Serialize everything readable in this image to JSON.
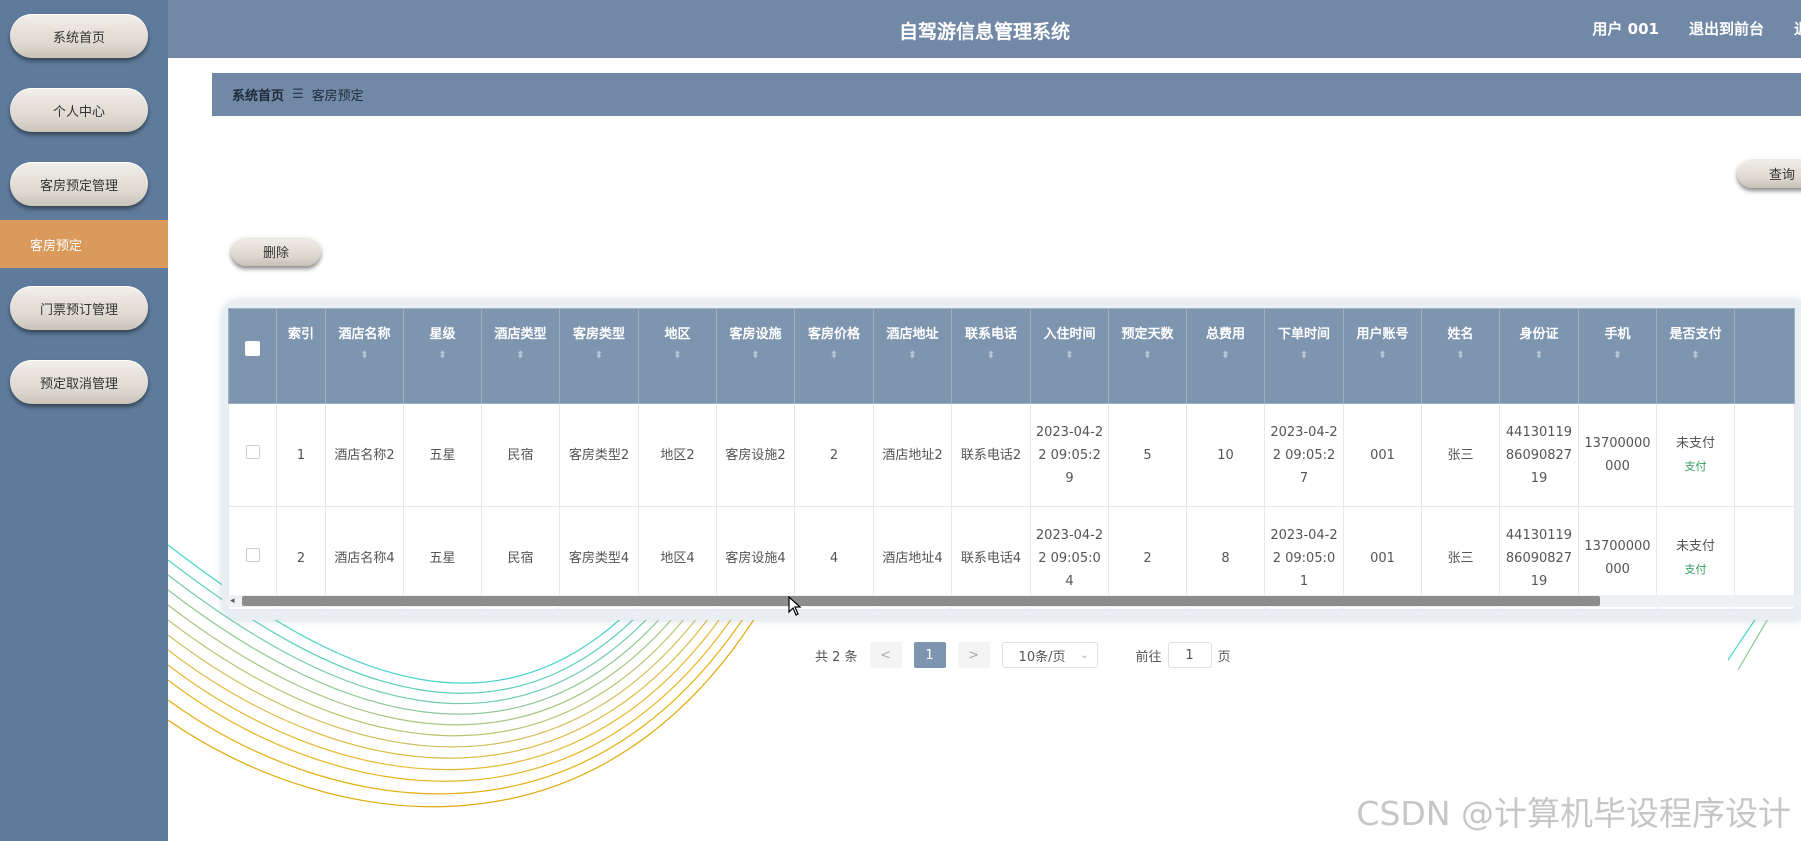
{
  "app": {
    "title": "自驾游信息管理系统"
  },
  "header": {
    "user": "用户 001",
    "back_label": "退出到前台",
    "logout_partial": "退"
  },
  "sidebar": {
    "items": [
      {
        "label": "系统首页"
      },
      {
        "label": "个人中心"
      },
      {
        "label": "客房预定管理"
      },
      {
        "label": "客房预定"
      },
      {
        "label": "门票预订管理"
      },
      {
        "label": "预定取消管理"
      }
    ]
  },
  "breadcrumb": {
    "home": "系统首页",
    "separator": "☰",
    "current": "客房预定"
  },
  "toolbar": {
    "search_label": "查询",
    "delete_label": "删除"
  },
  "table": {
    "columns": [
      "索引",
      "酒店名称",
      "星级",
      "酒店类型",
      "客房类型",
      "地区",
      "客房设施",
      "客房价格",
      "酒店地址",
      "联系电话",
      "入住时间",
      "预定天数",
      "总费用",
      "下单时间",
      "用户账号",
      "姓名",
      "身份证",
      "手机",
      "是否支付"
    ],
    "rows": [
      {
        "index": "1",
        "hotel_name": "酒店名称2",
        "star": "五星",
        "hotel_type": "民宿",
        "room_type": "客房类型2",
        "region": "地区2",
        "facility": "客房设施2",
        "price": "2",
        "address": "酒店地址2",
        "phone": "联系电话2",
        "checkin": "2023-04-22 09:05:29",
        "days": "5",
        "total": "10",
        "order_time": "2023-04-22 09:05:27",
        "account": "001",
        "name": "张三",
        "id_card": "441301198609082719",
        "mobile": "13700000000",
        "pay_status": "未支付",
        "pay_action": "支付"
      },
      {
        "index": "2",
        "hotel_name": "酒店名称4",
        "star": "五星",
        "hotel_type": "民宿",
        "room_type": "客房类型4",
        "region": "地区4",
        "facility": "客房设施4",
        "price": "4",
        "address": "酒店地址4",
        "phone": "联系电话4",
        "checkin": "2023-04-22 09:05:04",
        "days": "2",
        "total": "8",
        "order_time": "2023-04-22 09:05:01",
        "account": "001",
        "name": "张三",
        "id_card": "441301198609082719",
        "mobile": "13700000000",
        "pay_status": "未支付",
        "pay_action": "支付"
      }
    ]
  },
  "pagination": {
    "total_text": "共 2 条",
    "prev": "<",
    "current_page": "1",
    "next": ">",
    "page_size": "10条/页",
    "goto_label": "前往",
    "goto_value": "1",
    "page_unit": "页"
  },
  "watermark": "CSDN @计算机毕设程序设计",
  "colors": {
    "sidebar": "#5f7b9c",
    "header": "#7188a6",
    "active_sub": "#d99a5c",
    "table_header": "#7e95b0"
  }
}
